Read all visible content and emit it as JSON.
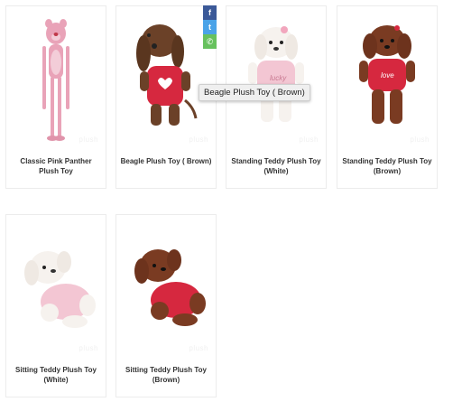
{
  "products": [
    {
      "name": "Classic Pink Panther Plush Toy",
      "image": "pink-panther-plush-image"
    },
    {
      "name": "Beagle Plush Toy ( Brown)",
      "image": "beagle-plush-image"
    },
    {
      "name": "Standing Teddy Plush Toy (White)",
      "image": "white-teddy-standing-image"
    },
    {
      "name": "Standing Teddy Plush Toy (Brown)",
      "image": "brown-teddy-standing-image"
    },
    {
      "name": "Sitting Teddy Plush Toy (White)",
      "image": "white-teddy-sitting-image"
    },
    {
      "name": "Sitting Teddy Plush Toy (Brown)",
      "image": "brown-teddy-sitting-image"
    }
  ],
  "share": {
    "facebook": {
      "glyph": "f",
      "icon": "facebook-icon",
      "color": "#3b5998"
    },
    "twitter": {
      "glyph": "t",
      "icon": "twitter-icon",
      "color": "#4aa3e8"
    },
    "whatsapp": {
      "glyph": "✆",
      "icon": "whatsapp-icon",
      "color": "#67c15e"
    }
  },
  "tooltip": {
    "text": "Beagle Plush Toy ( Brown)"
  }
}
